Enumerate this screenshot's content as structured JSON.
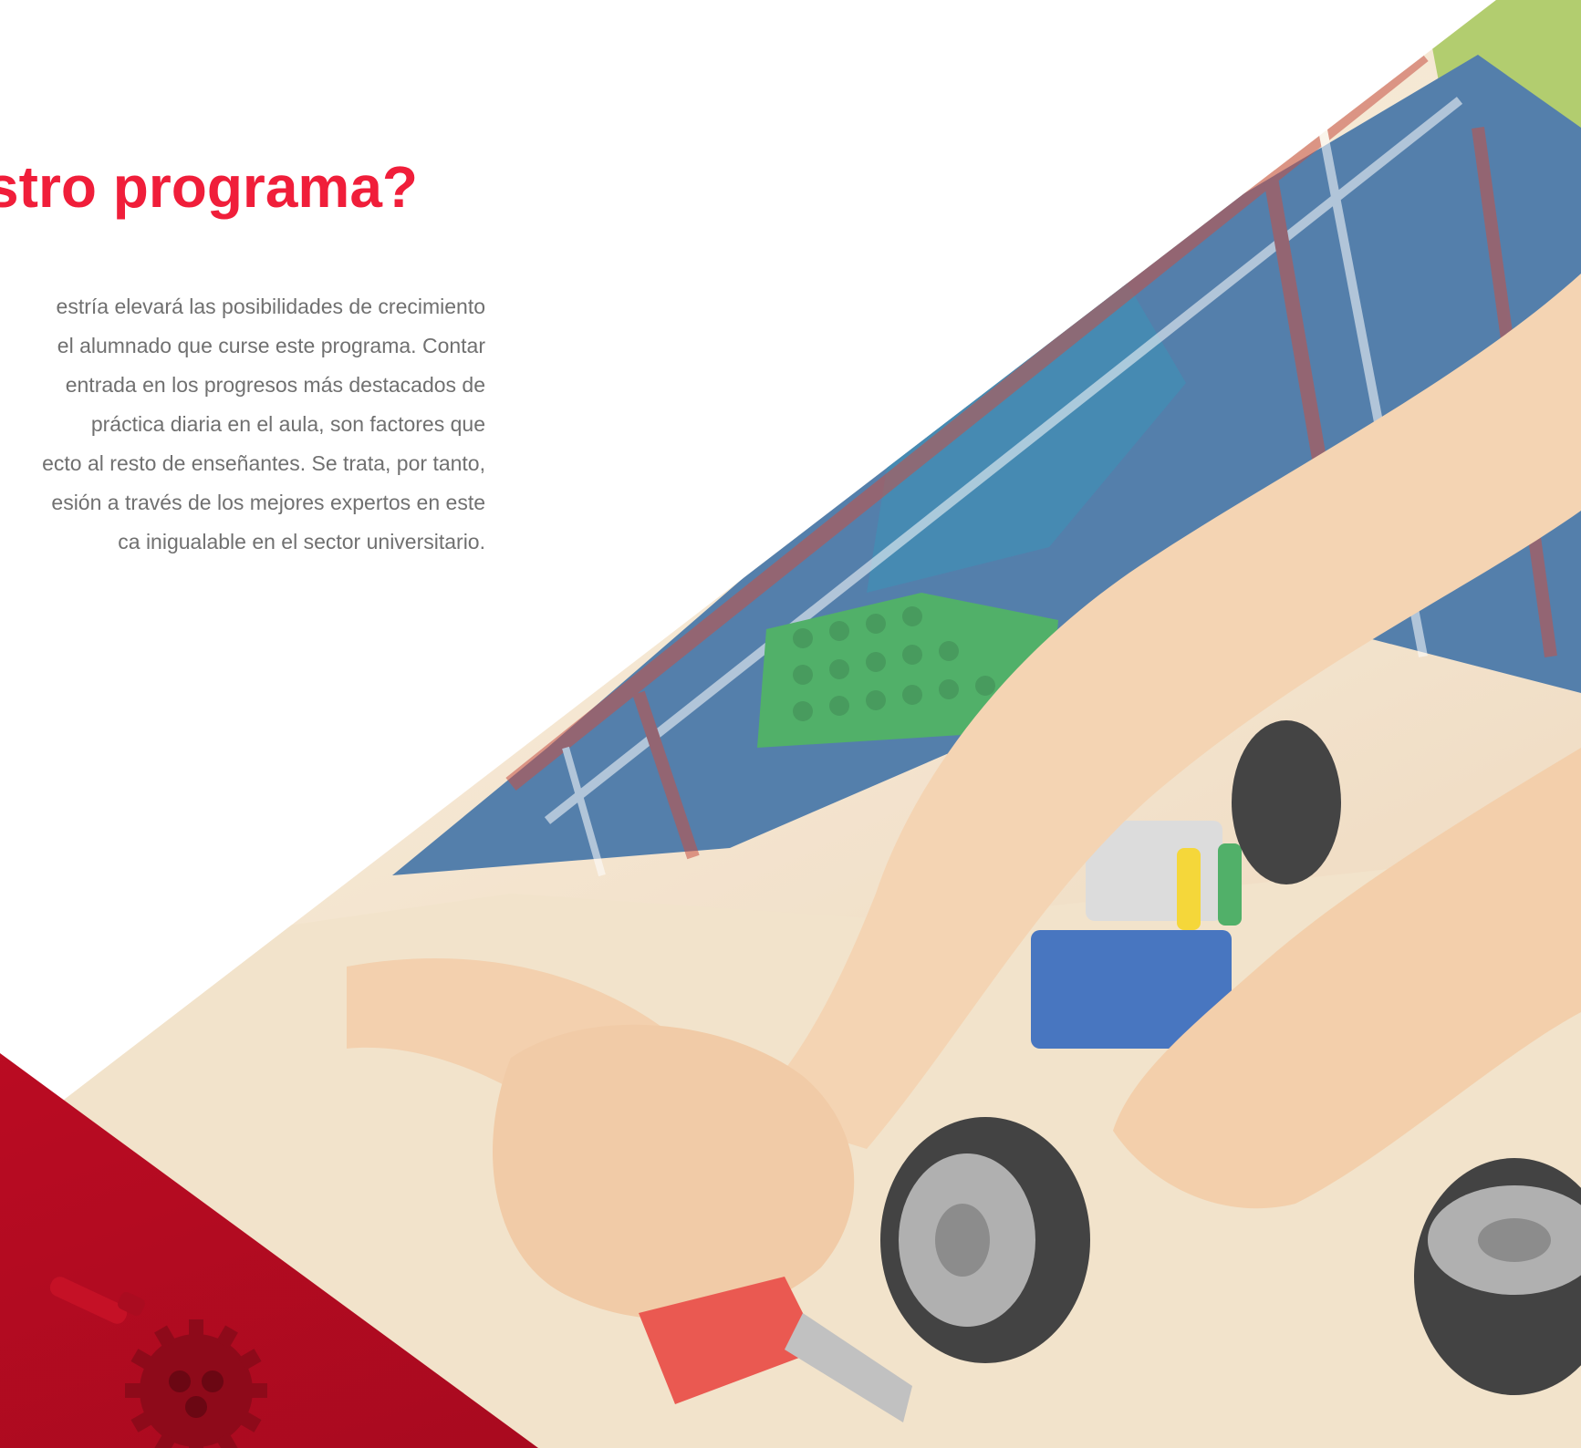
{
  "section": {
    "heading": "stro programa?",
    "paragraph_lines": [
      "estría elevará las posibilidades de crecimiento",
      "el alumnado que curse este programa. Contar",
      "entrada en los progresos más destacados de",
      "práctica diaria en el aula, son factores que",
      "ecto al resto de enseñantes. Se trata, por tanto,",
      "esión a través de los mejores expertos en este",
      "ca inigualable en el sector universitario."
    ]
  },
  "colors": {
    "heading": "#f01e3a",
    "body_text": "#707070",
    "accent_red": "#d5132a"
  },
  "image": {
    "description_icon": "robotics-lego-photo"
  }
}
